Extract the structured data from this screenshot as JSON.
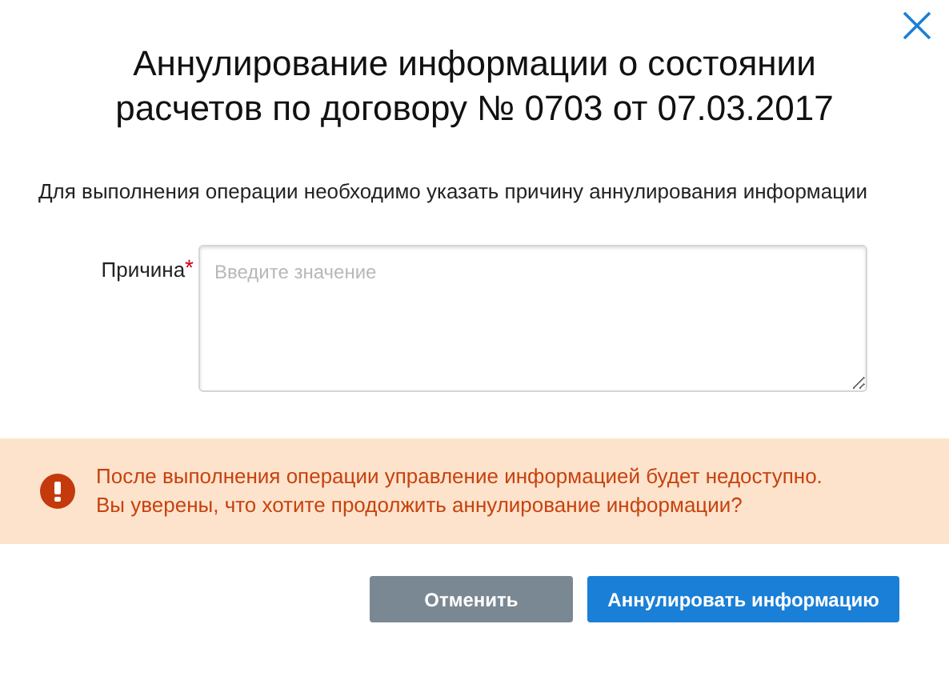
{
  "dialog": {
    "title_lines": [
      "Аннулирование информации о состоянии",
      "расчетов по договору № 0703 от 07.03.2017"
    ],
    "description": "Для выполнения операции необходимо указать причину аннулирования информации",
    "field": {
      "label": "Причина",
      "required_mark": "*",
      "placeholder": "Введите значение"
    },
    "warning": {
      "lines": [
        "После выполнения операции управление информацией будет недоступно.",
        "Вы уверены, что хотите продолжить аннулирование информации?"
      ]
    },
    "buttons": [
      {
        "label": "Отменить",
        "kind": "secondary"
      },
      {
        "label": "Аннулировать информацию",
        "kind": "primary"
      }
    ]
  }
}
